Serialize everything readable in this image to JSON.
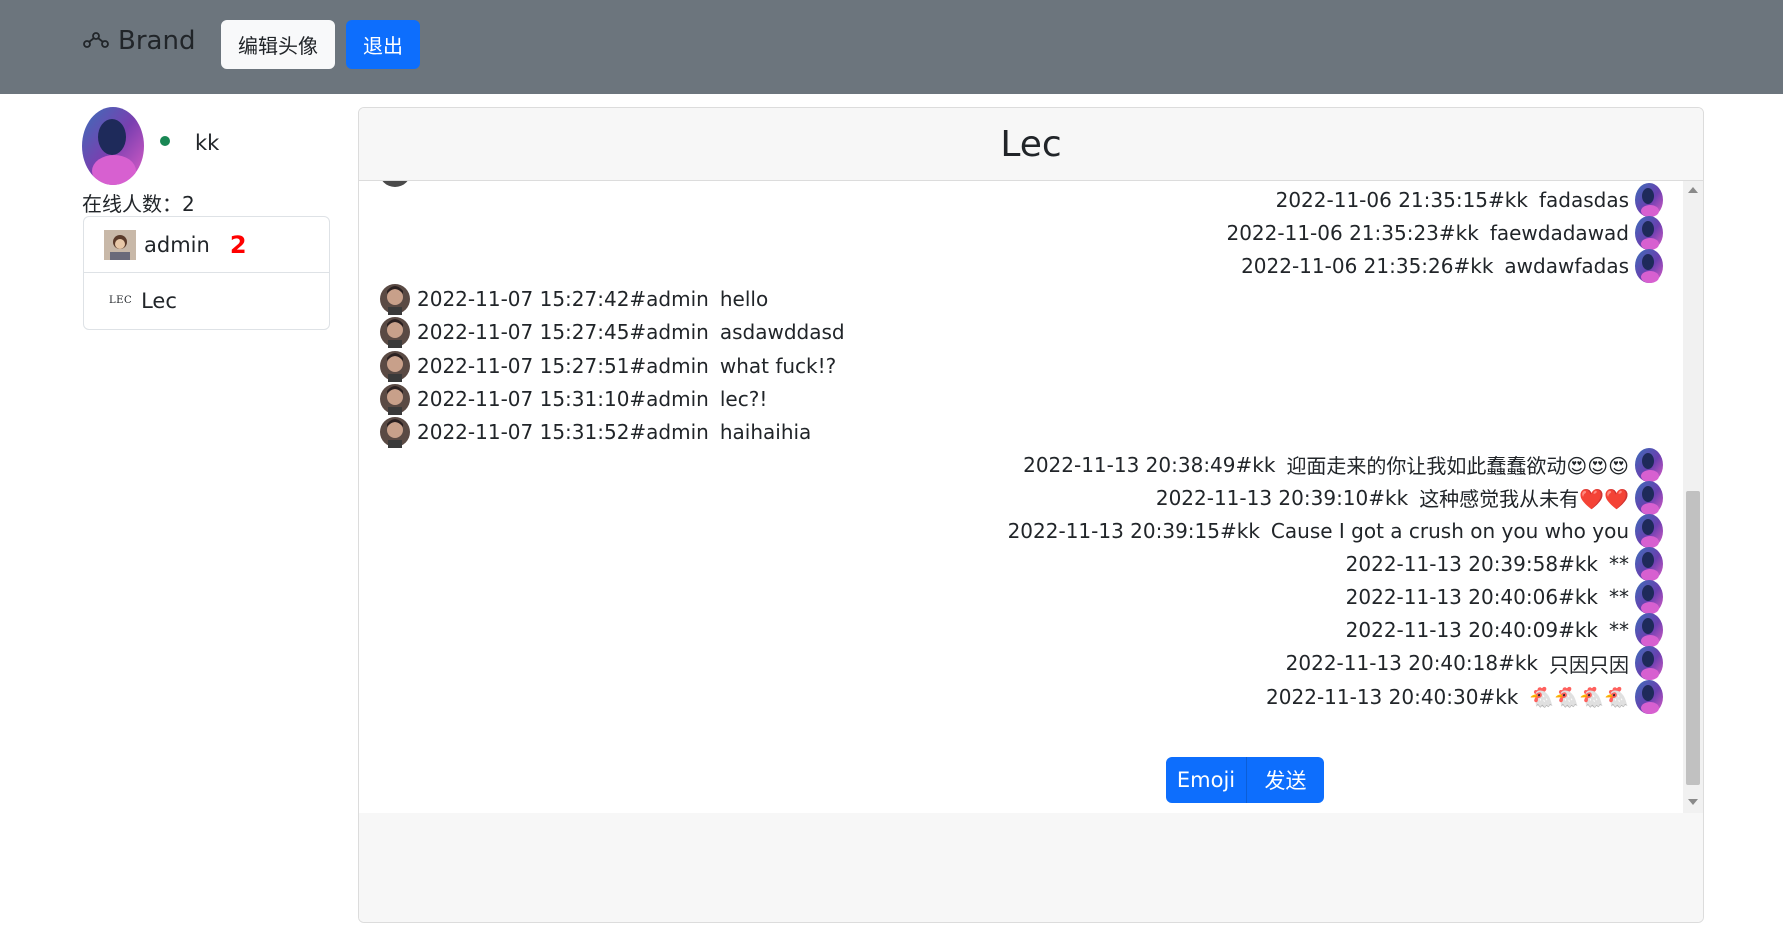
{
  "navbar": {
    "brand": "Brand",
    "edit_avatar_label": "编辑头像",
    "logout_label": "退出",
    "bg_color": "#6c757d"
  },
  "sidebar": {
    "current_user": "kk",
    "online_label": "在线人数：2",
    "users": [
      {
        "name": "admin",
        "badge": "2"
      },
      {
        "name": "Lec",
        "logo_text": "LEC"
      }
    ]
  },
  "chat": {
    "title": "Lec",
    "messages": [
      {
        "side": "right",
        "meta": "2022-11-06 21:35:15#kk",
        "text": "fadasdas"
      },
      {
        "side": "right",
        "meta": "2022-11-06 21:35:23#kk",
        "text": "faewdadawad"
      },
      {
        "side": "right",
        "meta": "2022-11-06 21:35:26#kk",
        "text": "awdawfadas"
      },
      {
        "side": "left",
        "meta": "2022-11-07 15:27:42#admin",
        "text": "hello"
      },
      {
        "side": "left",
        "meta": "2022-11-07 15:27:45#admin",
        "text": "asdawddasd"
      },
      {
        "side": "left",
        "meta": "2022-11-07 15:27:51#admin",
        "text": "what fuck!?"
      },
      {
        "side": "left",
        "meta": "2022-11-07 15:31:10#admin",
        "text": "lec?!"
      },
      {
        "side": "left",
        "meta": "2022-11-07 15:31:52#admin",
        "text": "haihaihia"
      },
      {
        "side": "right",
        "meta": "2022-11-13 20:38:49#kk",
        "text": "迎面走来的你让我如此蠢蠢欲动😍😍😍"
      },
      {
        "side": "right",
        "meta": "2022-11-13 20:39:10#kk",
        "text": "这种感觉我从未有❤️❤️"
      },
      {
        "side": "right",
        "meta": "2022-11-13 20:39:15#kk",
        "text": "Cause I got a crush on you who you"
      },
      {
        "side": "right",
        "meta": "2022-11-13 20:39:58#kk",
        "text": "**"
      },
      {
        "side": "right",
        "meta": "2022-11-13 20:40:06#kk",
        "text": "**"
      },
      {
        "side": "right",
        "meta": "2022-11-13 20:40:09#kk",
        "text": "**"
      },
      {
        "side": "right",
        "meta": "2022-11-13 20:40:18#kk",
        "text": "只因只因"
      },
      {
        "side": "right",
        "meta": "2022-11-13 20:40:30#kk",
        "text": "🐔🐔🐔🐔"
      }
    ],
    "emoji_label": "Emoji",
    "send_label": "发送",
    "accent_color": "#0d6efd"
  }
}
